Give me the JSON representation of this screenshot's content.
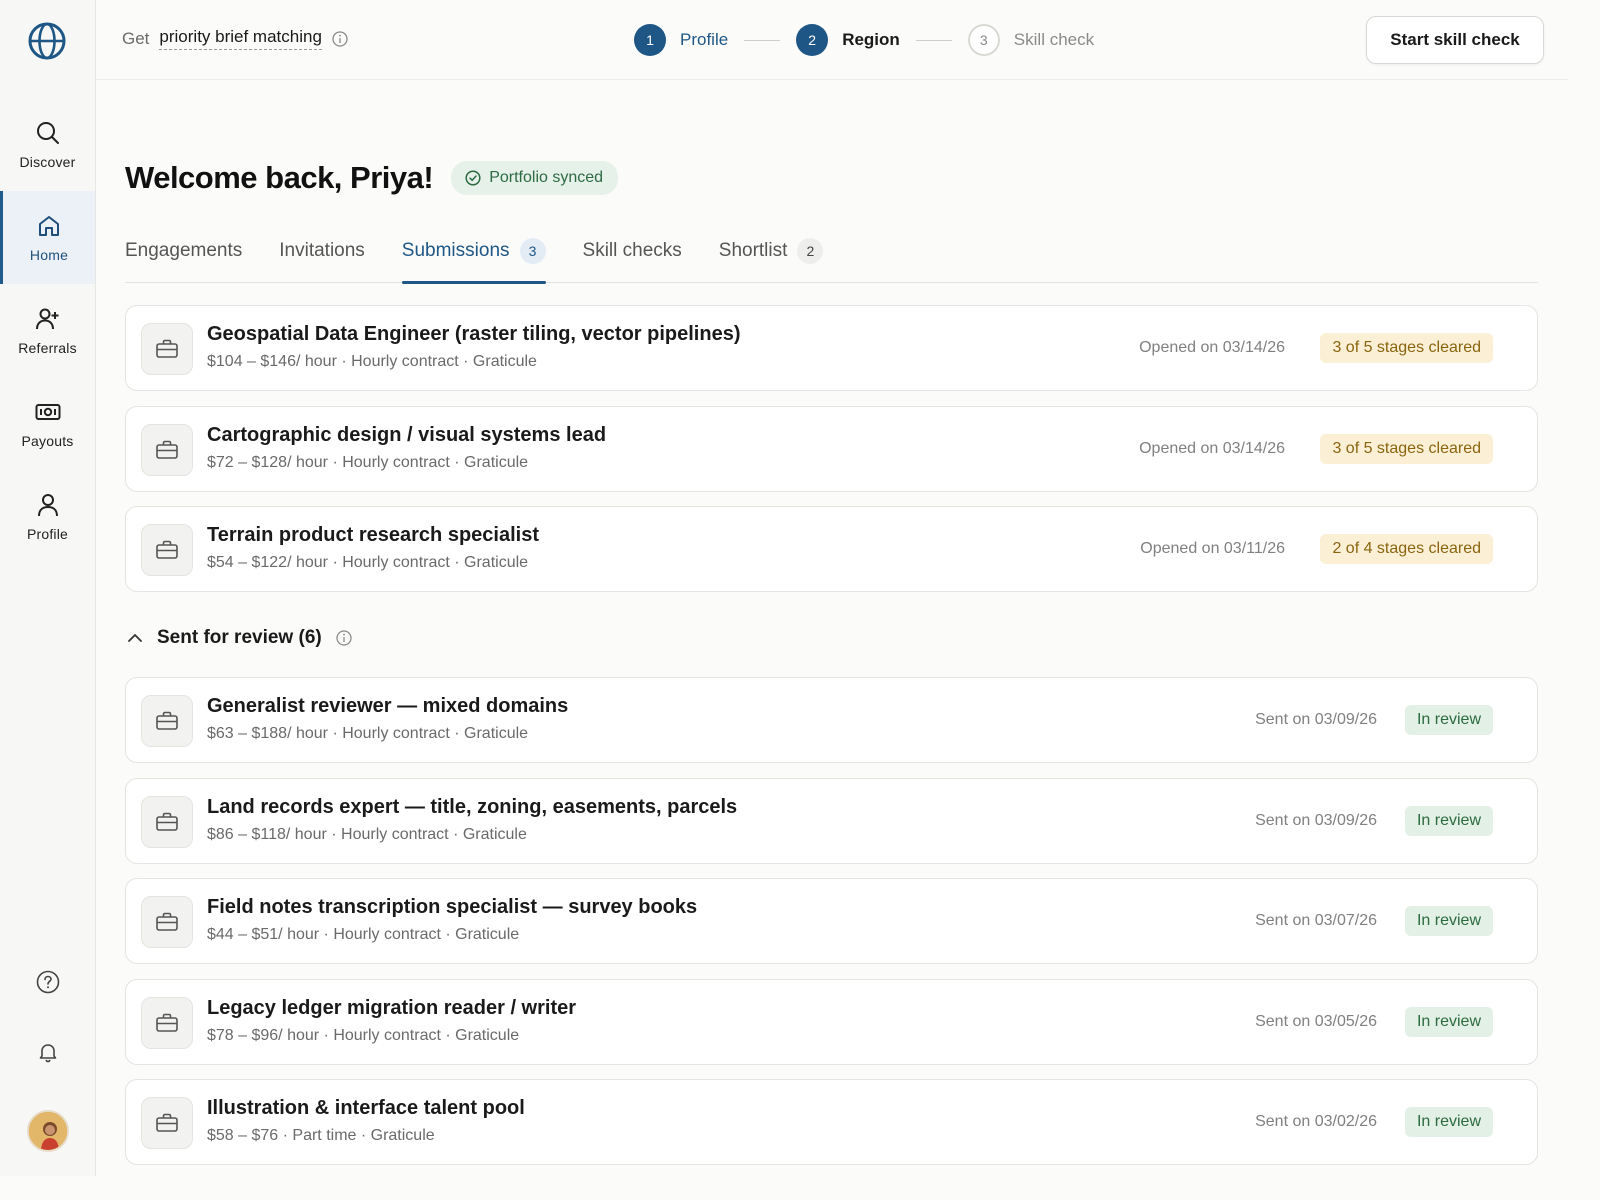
{
  "sidebar": {
    "items": [
      {
        "label": "Discover",
        "icon": "search-icon"
      },
      {
        "label": "Home",
        "icon": "home-icon"
      },
      {
        "label": "Referrals",
        "icon": "user-plus-icon"
      },
      {
        "label": "Payouts",
        "icon": "banknote-icon"
      },
      {
        "label": "Profile",
        "icon": "user-icon"
      }
    ],
    "active": "Home"
  },
  "header": {
    "promo_prefix": "Get",
    "promo_link": "priority brief matching",
    "steps": [
      {
        "num": "1",
        "label": "Profile",
        "state": "done"
      },
      {
        "num": "2",
        "label": "Region",
        "state": "current"
      },
      {
        "num": "3",
        "label": "Skill check",
        "state": "todo"
      }
    ],
    "cta": "Start skill check"
  },
  "welcome": {
    "title": "Welcome back, Priya!",
    "badge": "Portfolio synced"
  },
  "tabs": [
    {
      "label": "Engagements",
      "count": ""
    },
    {
      "label": "Invitations",
      "count": ""
    },
    {
      "label": "Submissions",
      "count": "3"
    },
    {
      "label": "Skill checks",
      "count": ""
    },
    {
      "label": "Shortlist",
      "count": "2"
    }
  ],
  "active_tab": "Submissions",
  "submissions": [
    {
      "title": "Geospatial Data Engineer (raster tiling, vector pipelines)",
      "meta": "$104 – $146/ hour · Hourly contract · Graticule",
      "date": "Opened on 03/14/26",
      "status": "3 of 5 stages cleared"
    },
    {
      "title": "Cartographic design / visual systems lead",
      "meta": "$72 – $128/ hour · Hourly contract · Graticule",
      "date": "Opened on 03/14/26",
      "status": "3 of 5 stages cleared"
    },
    {
      "title": "Terrain product research specialist",
      "meta": "$54 – $122/ hour · Hourly contract · Graticule",
      "date": "Opened on 03/11/26",
      "status": "2 of 4 stages cleared"
    }
  ],
  "review_section": {
    "label": "Sent for review (6)"
  },
  "reviews": [
    {
      "title": "Generalist reviewer — mixed domains",
      "meta": "$63 – $188/ hour · Hourly contract · Graticule",
      "date": "Sent on 03/09/26",
      "status": "In review"
    },
    {
      "title": "Land records expert — title, zoning, easements, parcels",
      "meta": "$86 – $118/ hour · Hourly contract · Graticule",
      "date": "Sent on 03/09/26",
      "status": "In review"
    },
    {
      "title": "Field notes transcription specialist — survey books",
      "meta": "$44 – $51/ hour · Hourly contract · Graticule",
      "date": "Sent on 03/07/26",
      "status": "In review"
    },
    {
      "title": "Legacy ledger migration reader / writer",
      "meta": "$78 – $96/ hour · Hourly contract · Graticule",
      "date": "Sent on 03/05/26",
      "status": "In review"
    },
    {
      "title": "Illustration & interface talent pool",
      "meta": "$58 – $76 · Part time · Graticule",
      "date": "Sent on 03/02/26",
      "status": "In review"
    }
  ],
  "colors": {
    "accent": "#1e5785",
    "stage_badge_bg": "#fbf0d6",
    "review_badge_bg": "#e3f0e6"
  }
}
